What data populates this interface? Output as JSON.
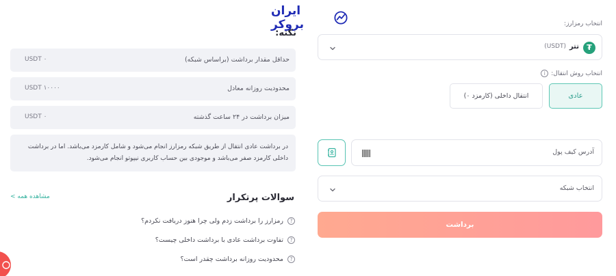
{
  "brand": {
    "name": "ایران بروکر",
    "color": "#1f2bb5"
  },
  "form": {
    "coin_label": "انتخاب رمزارز:",
    "coin": {
      "name": "تتر",
      "code": "(USDT)",
      "icon": "tether-icon",
      "icon_color": "#26a17b"
    },
    "method_label": "انتخاب روش انتقال:",
    "methods": [
      {
        "label": "عادی",
        "selected": true
      },
      {
        "label": "انتقال داخلی (کارمزد ۰)",
        "selected": false
      }
    ],
    "wallet_placeholder": "آدرس کیف پول",
    "network_placeholder": "انتخاب شبکه",
    "submit_label": "برداشت",
    "accent": "#5cc7b4",
    "submit_color": "#ffa990"
  },
  "note": {
    "title": "نکته:",
    "rows": [
      {
        "label": "حداقل مقدار برداشت (براساس شبکه)",
        "value": "USDT ۰"
      },
      {
        "label": "محدودیت روزانه معادل",
        "value": "USDT ۱۰۰۰۰"
      },
      {
        "label": "میزان برداشت در ۲۴ ساعت گذشته",
        "value": "USDT ۰"
      }
    ],
    "text_line1": "در برداشت عادی انتقال از طریق شبکه رمزارز انجام می‌شود و شامل کارمزد می‌باشد. اما در برداشت",
    "text_line2": "داخلی کارمزد صفر می‌باشد و موجودی بین حساب کاربری نیپوتو انجام می‌شود."
  },
  "faq": {
    "title": "سوالات پرتکرار",
    "view_all": "مشاهده همه >",
    "items": [
      "رمزارز را برداشت زدم ولی چرا هنوز دریافت نکردم؟",
      "تفاوت برداشت عادی با برداشت داخلی چیست؟",
      "محدودیت روزانه برداشت چقدر است؟"
    ]
  }
}
